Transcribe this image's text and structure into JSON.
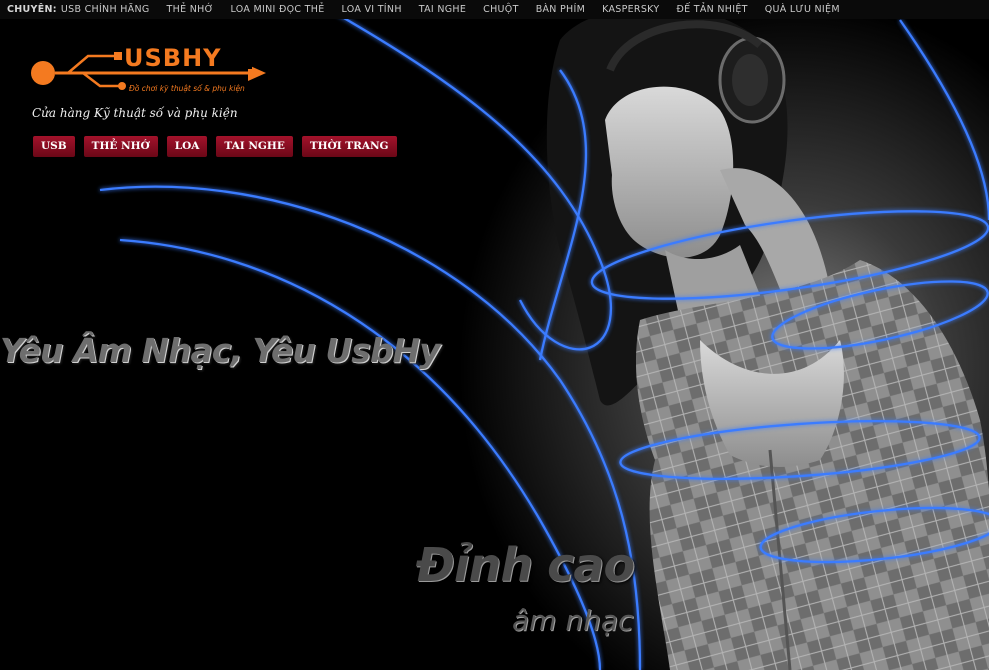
{
  "topbar": {
    "prefix": "CHUYÊN:",
    "links": [
      "USB CHÍNH HÃNG",
      "THẺ NHỚ",
      "LOA MINI ĐỌC THẺ",
      "LOA VI TÍNH",
      "TAI NGHE",
      "CHUỘT",
      "BÀN PHÍM",
      "KASPERSKY",
      "ĐẾ TẢN NHIỆT",
      "QUÀ LƯU NIỆM"
    ]
  },
  "logo": {
    "text": "USBHY",
    "subtitle": "Đồ chơi kỹ thuật số & phụ kiện",
    "color": "#f47a20"
  },
  "tagline": "Cửa hàng Kỹ thuật số và phụ kiện",
  "categories": [
    "USB",
    "THẺ NHỚ",
    "LOA",
    "TAI NGHE",
    "THỜI TRANG"
  ],
  "slogan": "Yêu Âm Nhạc, Yêu UsbHy",
  "banner_text": {
    "line1": "Đỉnh cao",
    "line2": "âm nhạc"
  },
  "colors": {
    "accent": "#f47a20",
    "button": "#8c0e22",
    "neon": "#2f6bff"
  }
}
